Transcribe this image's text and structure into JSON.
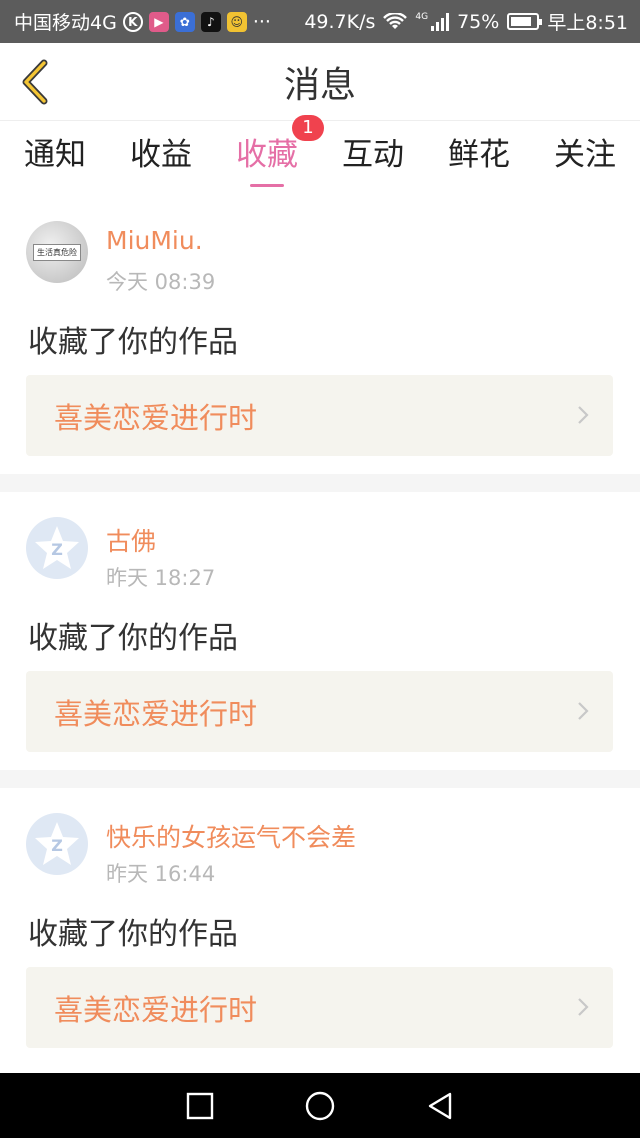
{
  "status_bar": {
    "carrier": "中国移动4G",
    "more": "···",
    "speed": "49.7K/s",
    "network": "4G",
    "battery": "75%",
    "time": "早上8:51",
    "app_icons": [
      "k-icon",
      "bilibili-icon",
      "baidu-paw-icon",
      "tiktok-icon",
      "face-icon"
    ]
  },
  "header": {
    "title": "消息"
  },
  "tabs": [
    {
      "label": "通知"
    },
    {
      "label": "收益"
    },
    {
      "label": "收藏",
      "active": true,
      "badge": "1"
    },
    {
      "label": "互动"
    },
    {
      "label": "鲜花"
    },
    {
      "label": "关注"
    }
  ],
  "avatar_sign_text": "生活真危险",
  "messages": [
    {
      "username": "MiuMiu.",
      "time": "今天 08:39",
      "action": "收藏了你的作品",
      "work": "喜美恋爱进行时"
    },
    {
      "username": "古佛",
      "time": "昨天 18:27",
      "action": "收藏了你的作品",
      "work": "喜美恋爱进行时"
    },
    {
      "username": "快乐的女孩运气不会差",
      "time": "昨天 16:44",
      "action": "收藏了你的作品",
      "work": "喜美恋爱进行时"
    }
  ],
  "colors": {
    "accent_pink": "#e56fa6",
    "username_orange": "#f08c5c",
    "badge_red": "#f0424e",
    "card_bg": "#f5f4ee"
  }
}
